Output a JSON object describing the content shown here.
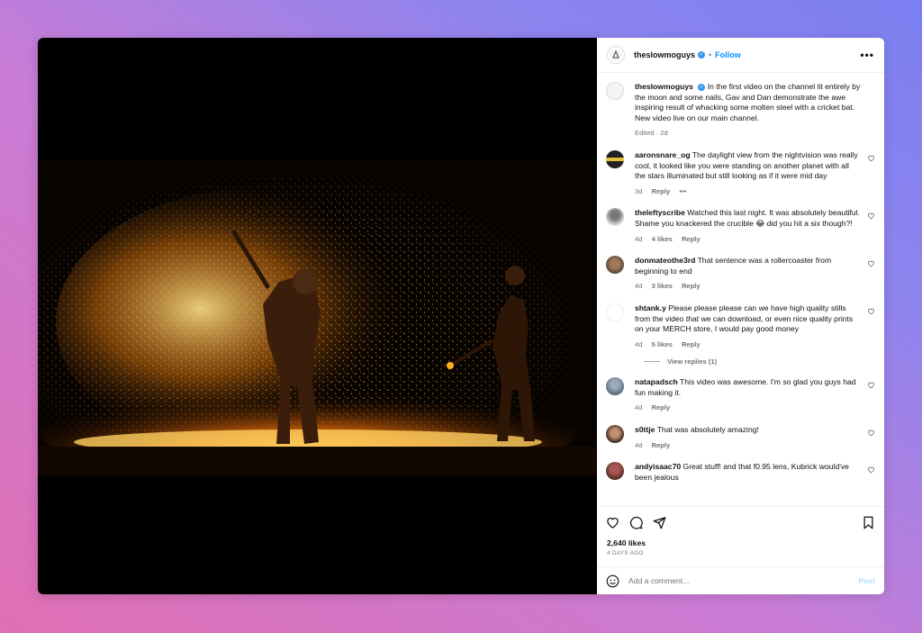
{
  "header": {
    "username": "theslowmoguys",
    "separator": "•",
    "follow_label": "Follow",
    "more_label": "•••"
  },
  "caption": {
    "username": "theslowmoguys",
    "text": "In the first video on the channel lit entirely by the moon and some nails, Gav and Dan demonstrate the awe inspiring result of whacking some molten steel with a cricket bat. New video live on our main channel.",
    "meta": "Edited · 2d"
  },
  "comments": [
    {
      "user": "aaronsnare_og",
      "text": "The daylight view from the nightvision was really cool, it looked like you were standing on another planet with all the stars illuminated but still looking as if it were mid day",
      "time": "3d",
      "likes": "",
      "reply": "Reply",
      "extra": "•••"
    },
    {
      "user": "theleftyscribe",
      "text": "Watched this last night. It was absolutely beautiful. Shame you knackered the crucible 😂 did you hit a six though?!",
      "time": "4d",
      "likes": "4 likes",
      "reply": "Reply"
    },
    {
      "user": "donmateothe3rd",
      "text": "That sentence was a rollercoaster from beginning to end",
      "time": "4d",
      "likes": "3 likes",
      "reply": "Reply"
    },
    {
      "user": "shtank.y",
      "text": "Please please please can we have high quality stills from the video that we can download, or even nice quality prints on your MERCH store, I would pay good money",
      "time": "4d",
      "likes": "5 likes",
      "reply": "Reply"
    },
    {
      "user": "natapadsch",
      "text": "This video was awesome. I'm so glad you guys had fun making it.",
      "time": "4d",
      "likes": "",
      "reply": "Reply"
    },
    {
      "user": "s0ttje",
      "text": "That was absolutely amazing!",
      "time": "4d",
      "likes": "",
      "reply": "Reply"
    },
    {
      "user": "andyisaac70",
      "text": "Great stuff! and that f0.95 lens, Kubrick would've been jealous",
      "time": "",
      "likes": "",
      "reply": ""
    }
  ],
  "view_replies": "View replies (1)",
  "likes_count": "2,640 likes",
  "posted_ago": "4 DAYS AGO",
  "add_comment": {
    "placeholder": "Add a comment...",
    "post_label": "Post"
  },
  "colors": {
    "follow": "#0095f6",
    "verified": "#3797f0",
    "meta": "#737373"
  }
}
